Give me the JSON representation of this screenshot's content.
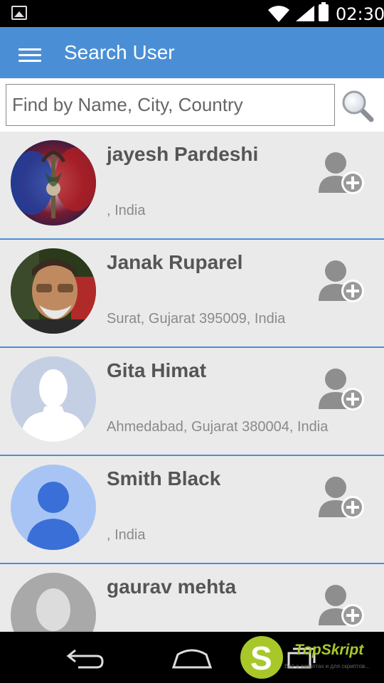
{
  "status_bar": {
    "time": "02:30",
    "icons": [
      "gallery-icon",
      "wifi-icon",
      "signal-icon",
      "battery-icon"
    ]
  },
  "app_bar": {
    "title": "Search User",
    "menu_icon": "menu-icon",
    "color": "#4a8fd6"
  },
  "search": {
    "placeholder": "Find by Name, City, Country",
    "value": "",
    "icon": "search-icon"
  },
  "users": [
    {
      "name": "jayesh Pardeshi",
      "location": ", India",
      "avatar": "emblem-photo"
    },
    {
      "name": "Janak Ruparel",
      "location": "Surat, Gujarat 395009, India",
      "avatar": "man-photo"
    },
    {
      "name": "Gita Himat",
      "location": "Ahmedabad, Gujarat 380004, India",
      "avatar": "default-silhouette"
    },
    {
      "name": "Smith Black",
      "location": ", India",
      "avatar": "default-person-blue"
    },
    {
      "name": "gaurav mehta",
      "location": "",
      "avatar": "default-person-gray"
    }
  ],
  "nav_bar": {
    "icons": [
      "back-icon",
      "home-icon",
      "recent-apps-icon"
    ]
  },
  "watermark": {
    "letter": "S",
    "brand": "TopSkript",
    "tagline": "Всё о скриптах и для скриптов..."
  },
  "colors": {
    "accent": "#4a8fd6",
    "row_background": "#eaeaea",
    "name_text": "#555555",
    "location_text": "#8a8a8a",
    "logo_green": "#a8c82a"
  }
}
